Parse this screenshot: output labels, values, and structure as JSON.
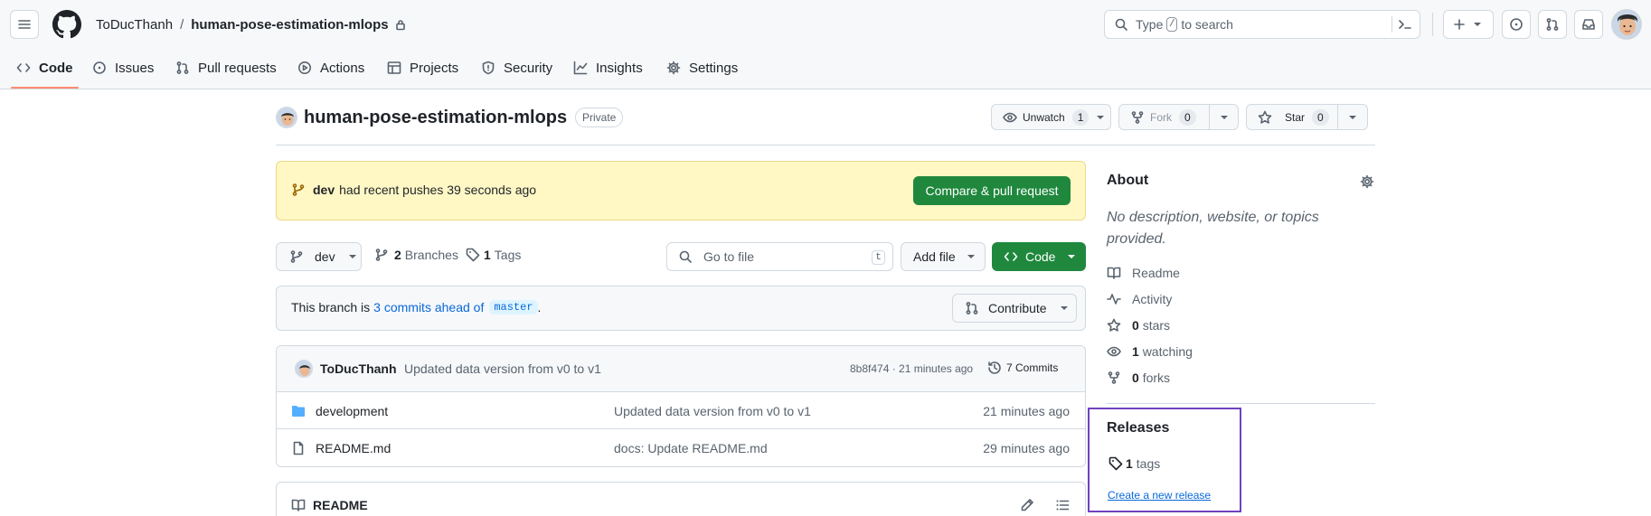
{
  "header": {
    "owner": "ToDucThanh",
    "separator": "/",
    "repo": "human-pose-estimation-mlops",
    "search_prefix": "Type",
    "search_key": "/",
    "search_suffix": "to search"
  },
  "nav_tabs": [
    {
      "label": "Code",
      "icon": "code-icon",
      "active": true
    },
    {
      "label": "Issues",
      "icon": "issue-icon"
    },
    {
      "label": "Pull requests",
      "icon": "pull-request-icon"
    },
    {
      "label": "Actions",
      "icon": "play-icon"
    },
    {
      "label": "Projects",
      "icon": "table-icon"
    },
    {
      "label": "Security",
      "icon": "shield-icon"
    },
    {
      "label": "Insights",
      "icon": "graph-icon"
    },
    {
      "label": "Settings",
      "icon": "gear-icon"
    }
  ],
  "repo_title": {
    "name": "human-pose-estimation-mlops",
    "visibility": "Private",
    "unwatch_label": "Unwatch",
    "unwatch_count": "1",
    "fork_label": "Fork",
    "fork_count": "0",
    "star_label": "Star",
    "star_count": "0"
  },
  "push_banner": {
    "branch": "dev",
    "message": "had recent pushes 39 seconds ago",
    "button": "Compare & pull request"
  },
  "toolbar": {
    "branch": "dev",
    "branches_count": "2",
    "branches_label": "Branches",
    "tags_count": "1",
    "tags_label": "Tags",
    "goto_placeholder": "Go to file",
    "goto_key": "t",
    "add_file": "Add file",
    "code_button": "Code"
  },
  "ahead_banner": {
    "prefix": "This branch is",
    "link": "3 commits ahead of",
    "base": "master",
    "suffix": ".",
    "contribute": "Contribute"
  },
  "commit": {
    "author": "ToDucThanh",
    "message": "Updated data version from v0 to v1",
    "hash_time": "8b8f474 · 21 minutes ago",
    "commits_label": "7 Commits"
  },
  "files": [
    {
      "name": "development",
      "type": "folder",
      "message": "Updated data version from v0 to v1",
      "time": "21 minutes ago"
    },
    {
      "name": "README.md",
      "type": "file",
      "message": "docs: Update README.md",
      "time": "29 minutes ago"
    }
  ],
  "readme": {
    "title": "README"
  },
  "about": {
    "title": "About",
    "description": "No description, website, or topics provided.",
    "readme": "Readme",
    "activity": "Activity",
    "stars_count": "0",
    "stars_label": "stars",
    "watching_count": "1",
    "watching_label": "watching",
    "forks_count": "0",
    "forks_label": "forks"
  },
  "releases": {
    "title": "Releases",
    "tags_count": "1",
    "tags_label": "tags",
    "create_link": "Create a new release"
  },
  "colors": {
    "accent_green": "#1f883d",
    "banner_bg": "#fff8c5",
    "link_blue": "#0969da",
    "active_tab_underline": "#fd8c73",
    "highlight_box": "#6f42c1"
  }
}
